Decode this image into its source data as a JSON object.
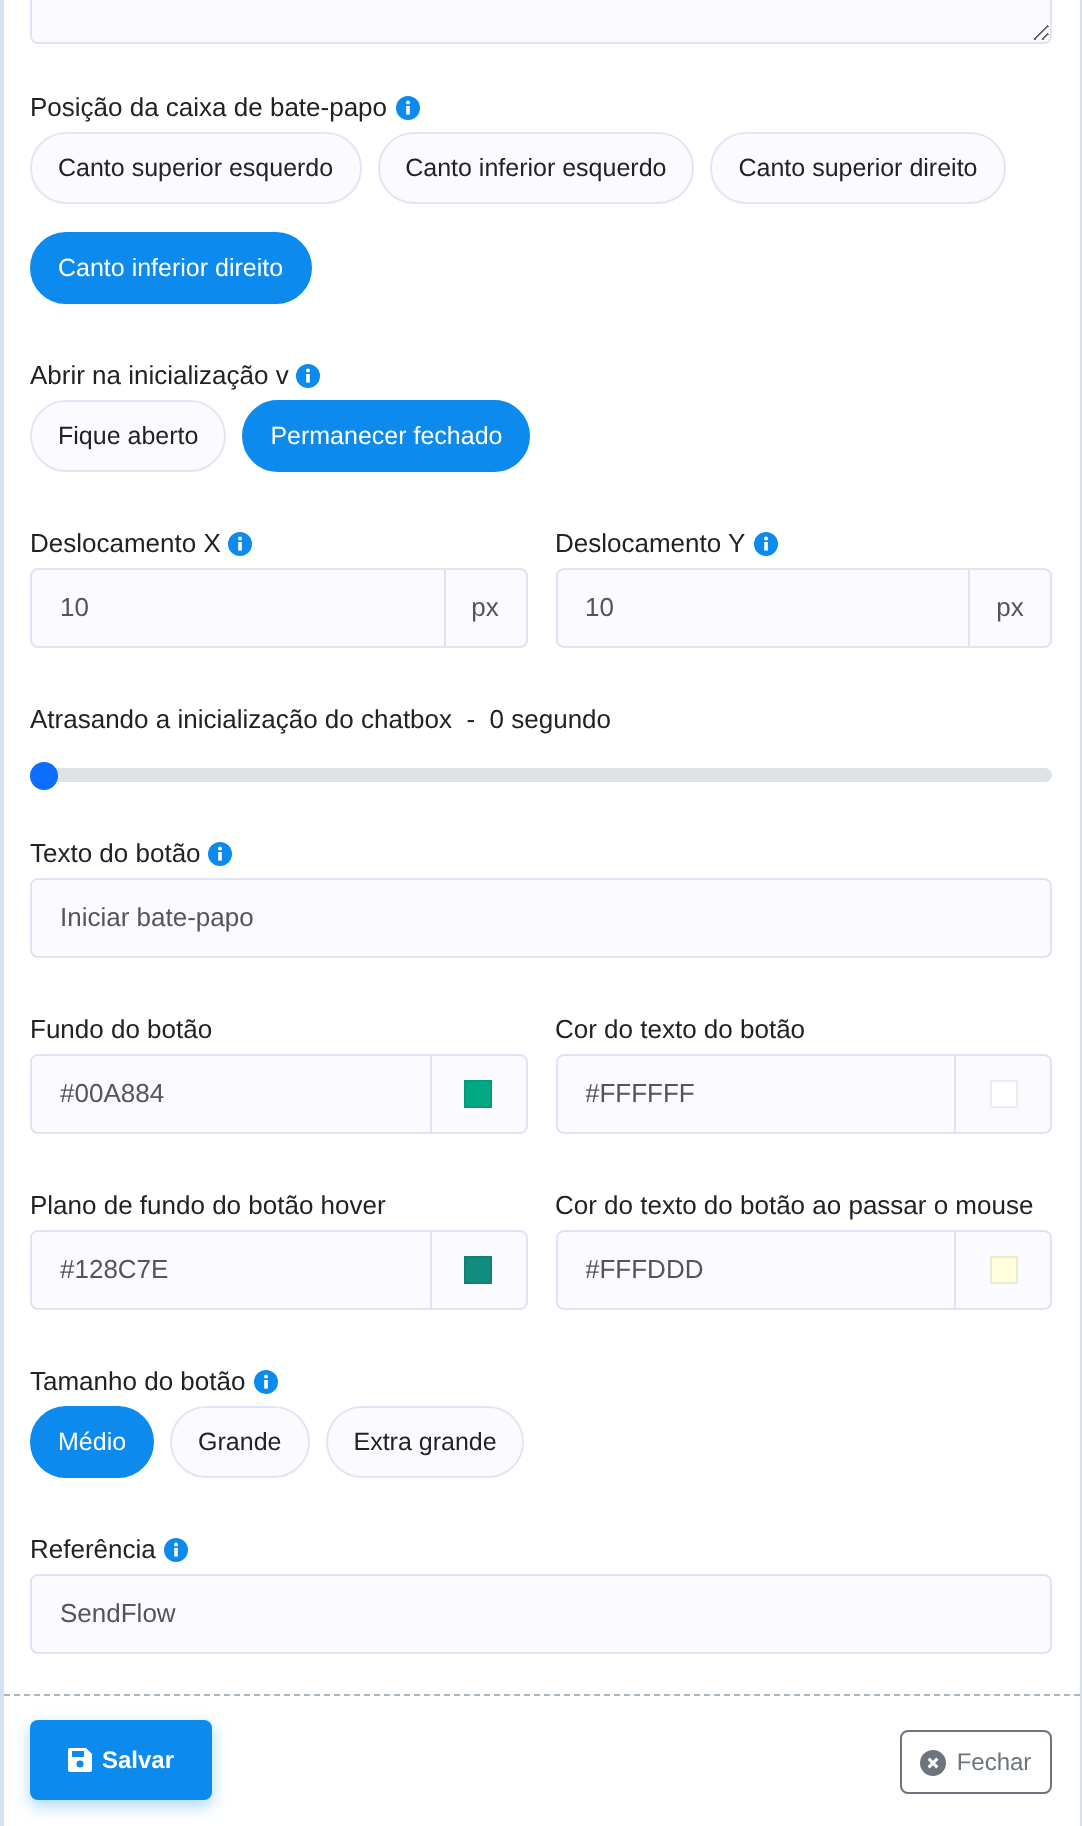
{
  "fields": [
    {
      "kind": "choice",
      "label": "Posição da caixa de bate-papo",
      "info": true,
      "options": [
        {
          "label": "Canto superior esquerdo",
          "selected": false
        },
        {
          "label": "Canto inferior esquerdo",
          "selected": false
        },
        {
          "label": "Canto superior direito",
          "selected": false
        },
        {
          "label": "Canto inferior direito",
          "selected": true
        }
      ]
    },
    {
      "kind": "choice",
      "label": "Abrir na inicialização v",
      "info": true,
      "options": [
        {
          "label": "Fique aberto",
          "selected": false
        },
        {
          "label": "Permanecer fechado",
          "selected": true
        }
      ]
    },
    {
      "kind": "pair",
      "items": [
        {
          "kind": "unit",
          "label": "Deslocamento X",
          "info": true,
          "value": "10",
          "unit": "px"
        },
        {
          "kind": "unit",
          "label": "Deslocamento Y",
          "info": true,
          "value": "10",
          "unit": "px"
        }
      ]
    },
    {
      "kind": "slider",
      "label": "Atrasando a inicialização do chatbox  -  0 segundo",
      "level": 0
    },
    {
      "kind": "text",
      "label": "Texto do botão",
      "info": true,
      "value": "Iniciar bate-papo"
    },
    {
      "kind": "pair",
      "items": [
        {
          "kind": "color",
          "label": "Fundo do botão",
          "info": false,
          "value": "#00A884",
          "color": "#00a884"
        },
        {
          "kind": "color",
          "label": "Cor do texto do botão",
          "info": false,
          "value": "#FFFFFF",
          "color": "#ffffff"
        }
      ]
    },
    {
      "kind": "pair",
      "items": [
        {
          "kind": "color",
          "label": "Plano de fundo do botão hover",
          "info": false,
          "value": "#128C7E",
          "color": "#128c7e"
        },
        {
          "kind": "color",
          "label": "Cor do texto do botão ao passar o mouse",
          "info": false,
          "value": "#FFFDDD",
          "color": "#fffddd"
        }
      ]
    },
    {
      "kind": "choice",
      "label": "Tamanho do botão",
      "info": true,
      "options": [
        {
          "label": "Médio",
          "selected": true
        },
        {
          "label": "Grande",
          "selected": false
        },
        {
          "label": "Extra grande",
          "selected": false
        }
      ]
    },
    {
      "kind": "text",
      "label": "Referência",
      "info": true,
      "value": "SendFlow"
    }
  ],
  "footer": {
    "save": "Salvar",
    "close": "Fechar"
  }
}
